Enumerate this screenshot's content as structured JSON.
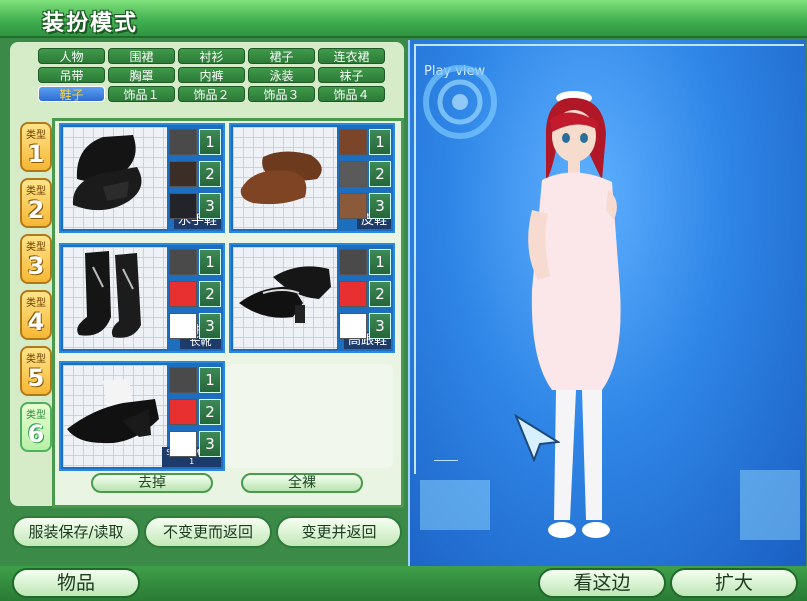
{
  "title": "装扮模式",
  "tabs": [
    {
      "label": "人物"
    },
    {
      "label": "围裙"
    },
    {
      "label": "衬衫"
    },
    {
      "label": "裙子"
    },
    {
      "label": "连衣裙"
    },
    {
      "label": "吊带"
    },
    {
      "label": "胸罩"
    },
    {
      "label": "内裤"
    },
    {
      "label": "泳装"
    },
    {
      "label": "袜子"
    },
    {
      "label": "鞋子"
    },
    {
      "label": "饰品１"
    },
    {
      "label": "饰品２"
    },
    {
      "label": "饰品３"
    },
    {
      "label": "饰品４"
    }
  ],
  "active_tab": "鞋子",
  "types": [
    {
      "label": "类型",
      "num": "1"
    },
    {
      "label": "类型",
      "num": "2"
    },
    {
      "label": "类型",
      "num": "3"
    },
    {
      "label": "类型",
      "num": "4"
    },
    {
      "label": "类型",
      "num": "5"
    },
    {
      "label": "类型",
      "num": "6"
    }
  ],
  "items": [
    {
      "name": "水手鞋",
      "colors": [
        "#4a4a4a",
        "#3a2e26",
        "#23242a"
      ],
      "options": [
        "1",
        "2",
        "3"
      ]
    },
    {
      "name": "皮鞋",
      "colors": [
        "#7a4528",
        "#5a5a5a",
        "#8a5a3a"
      ],
      "options": [
        "1",
        "2",
        "3"
      ]
    },
    {
      "name": "哥特式\n长靴",
      "colors": [
        "#4a4a4a",
        "#e83030",
        "#ffffff"
      ],
      "options": [
        "1",
        "2",
        "3"
      ]
    },
    {
      "name": "高跟鞋",
      "colors": [
        "#4a4a4a",
        "#e83030",
        "#ffffff"
      ],
      "options": [
        "1",
        "2",
        "3"
      ]
    },
    {
      "name": "Shoes Model\n1",
      "colors": [
        "#4a4a4a",
        "#e83030",
        "#ffffff"
      ],
      "options": [
        "1",
        "2",
        "3"
      ]
    }
  ],
  "remove_label": "去掉",
  "nude_label": "全裸",
  "save_load_label": "服装保存/读取",
  "no_change_label": "不变更而返回",
  "change_label": "变更并返回",
  "items_label": "物品",
  "look_here_label": "看这边",
  "zoom_label": "扩大",
  "view_label": "Play view"
}
